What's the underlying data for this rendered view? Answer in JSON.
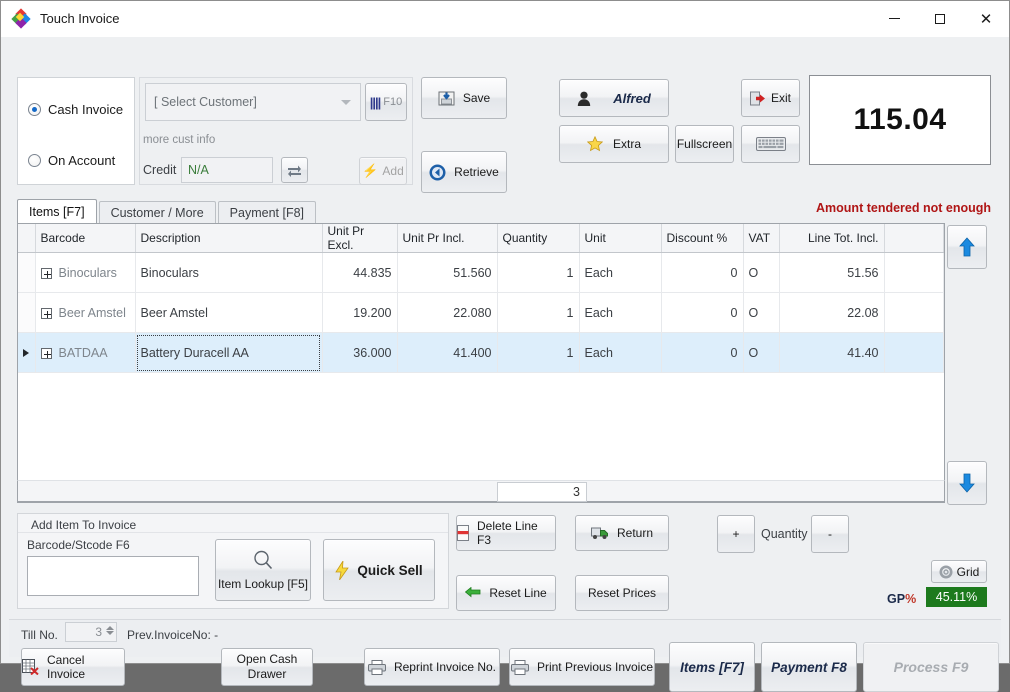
{
  "window": {
    "title": "Touch Invoice",
    "app_icon": "app-diamond-icon",
    "minimize": "–",
    "maximize": "□",
    "close": "✕"
  },
  "invoice_type": {
    "cash": {
      "label": "Cash Invoice",
      "selected": true
    },
    "account": {
      "label": "On Account",
      "selected": false
    }
  },
  "customer": {
    "select_placeholder": "[ Select Customer]",
    "f10_label": "F10",
    "more_info": "more cust info",
    "credit_label": "Credit",
    "credit_value": "N/A",
    "add_label": "Add"
  },
  "toolbar": {
    "save_label": "Save",
    "retrieve_label": "Retrieve",
    "user_label": "Alfred",
    "extra_label": "Extra",
    "fullscreen_label": "Fullscreen",
    "exit_label": "Exit",
    "keyboard_label": ""
  },
  "total": {
    "amount": "115.04",
    "warning": "Amount tendered not enough",
    "warning_color": "#b01515"
  },
  "tabs": [
    {
      "label": "Items [F7]",
      "active": true
    },
    {
      "label": "Customer / More",
      "active": false
    },
    {
      "label": "Payment [F8]",
      "active": false
    }
  ],
  "grid": {
    "columns": [
      "Barcode",
      "Description",
      "Unit Pr Excl.",
      "Unit Pr Incl.",
      "Quantity",
      "Unit",
      "Discount %",
      "VAT",
      "Line Tot. Incl.",
      ""
    ],
    "rows": [
      {
        "barcode": "Binoculars",
        "description": "Binoculars",
        "unit_pr_excl": "44.835",
        "unit_pr_incl": "51.560",
        "quantity": "1",
        "unit": "Each",
        "discount": "0",
        "vat": "O",
        "line_total": "51.56",
        "selected": false
      },
      {
        "barcode": "Beer Amstel",
        "description": "Beer Amstel",
        "unit_pr_excl": "19.200",
        "unit_pr_incl": "22.080",
        "quantity": "1",
        "unit": "Each",
        "discount": "0",
        "vat": "O",
        "line_total": "22.08",
        "selected": false
      },
      {
        "barcode": "BATDAA",
        "description": "Battery Duracell AA",
        "unit_pr_excl": "36.000",
        "unit_pr_incl": "41.400",
        "quantity": "1",
        "unit": "Each",
        "discount": "0",
        "vat": "O",
        "line_total": "41.40",
        "selected": true
      }
    ],
    "footer_count": "3",
    "nav_up": "up-arrow-icon",
    "nav_down": "down-arrow-icon"
  },
  "add_item": {
    "group_title": "Add Item To Invoice",
    "barcode_label": "Barcode/Stcode F6",
    "barcode_value": "",
    "lookup_label": "Item Lookup [F5]",
    "quick_sell_label": "Quick Sell"
  },
  "actions": {
    "delete_line": "Delete Line F3",
    "return": "Return",
    "plus": "+",
    "minus": "-",
    "quantity_label": "Quantity",
    "reset_line": "Reset Line",
    "reset_prices": "Reset Prices",
    "grid_label": "Grid",
    "gp_label_main": "GP",
    "gp_label_pct": "%",
    "gp_value": "45.11%",
    "gp_value_bg": "#1d7a1d"
  },
  "bottom": {
    "till_label": "Till No.",
    "till_value": "3",
    "prev_invoice": "Prev.InvoiceNo: -",
    "cancel_invoice": "Cancel Invoice",
    "open_cash_drawer_line1": "Open Cash",
    "open_cash_drawer_line2": "Drawer",
    "reprint_invoice": "Reprint Invoice No.",
    "print_previous": "Print Previous Invoice",
    "items_f7": "Items [F7]",
    "payment_f8": "Payment F8",
    "process_f9": "Process F9"
  }
}
